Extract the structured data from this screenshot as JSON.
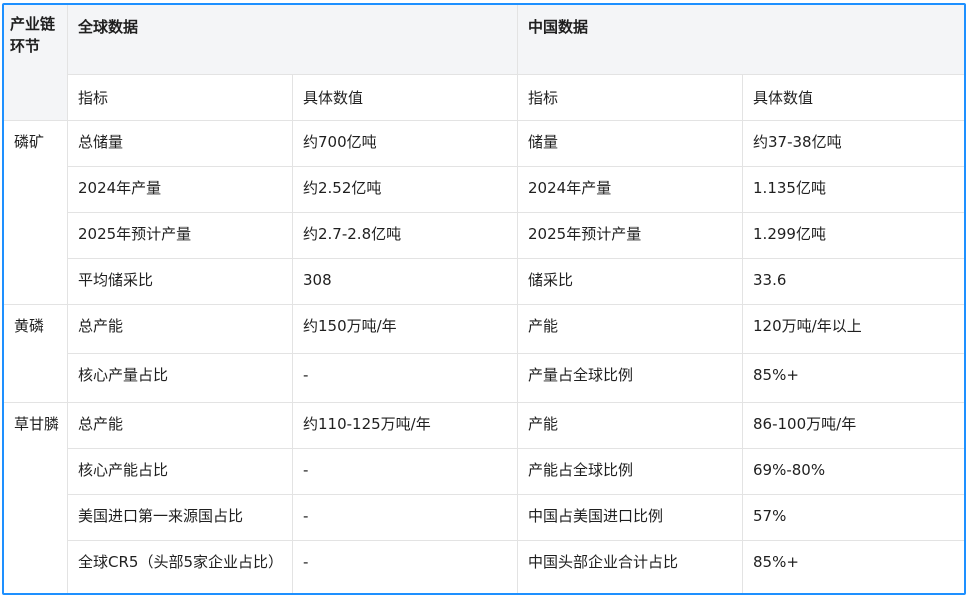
{
  "header": {
    "chain_label": "产业链环节",
    "global_label": "全球数据",
    "china_label": "中国数据",
    "col_indicator": "指标",
    "col_value": "具体数值"
  },
  "sections": [
    {
      "segment": "磷矿",
      "rows": [
        {
          "g_ind": "总储量",
          "g_val": "约700亿吨",
          "c_ind": "储量",
          "c_val": "约37-38亿吨"
        },
        {
          "g_ind": "2024年产量",
          "g_val": "约2.52亿吨",
          "c_ind": "2024年产量",
          "c_val": "1.135亿吨"
        },
        {
          "g_ind": "2025年预计产量",
          "g_val": "约2.7-2.8亿吨",
          "c_ind": "2025年预计产量",
          "c_val": "1.299亿吨"
        },
        {
          "g_ind": "平均储采比",
          "g_val": "308",
          "c_ind": "储采比",
          "c_val": "33.6"
        }
      ]
    },
    {
      "segment": "黄磷",
      "rows": [
        {
          "g_ind": "总产能",
          "g_val": "约150万吨/年",
          "c_ind": "产能",
          "c_val": "120万吨/年以上"
        },
        {
          "g_ind": "核心产量占比",
          "g_val": "-",
          "c_ind": "产量占全球比例",
          "c_val": "85%+"
        }
      ]
    },
    {
      "segment": "草甘膦",
      "rows": [
        {
          "g_ind": "总产能",
          "g_val": "约110-125万吨/年",
          "c_ind": "产能",
          "c_val": "86-100万吨/年"
        },
        {
          "g_ind": "核心产能占比",
          "g_val": "-",
          "c_ind": "产能占全球比例",
          "c_val": "69%-80%"
        },
        {
          "g_ind": "美国进口第一来源国占比",
          "g_val": "-",
          "c_ind": "中国占美国进口比例",
          "c_val": "57%"
        },
        {
          "g_ind": "全球CR5（头部5家企业占比）",
          "g_val": "-",
          "c_ind": "中国头部企业合计占比",
          "c_val": "85%+"
        }
      ]
    }
  ]
}
